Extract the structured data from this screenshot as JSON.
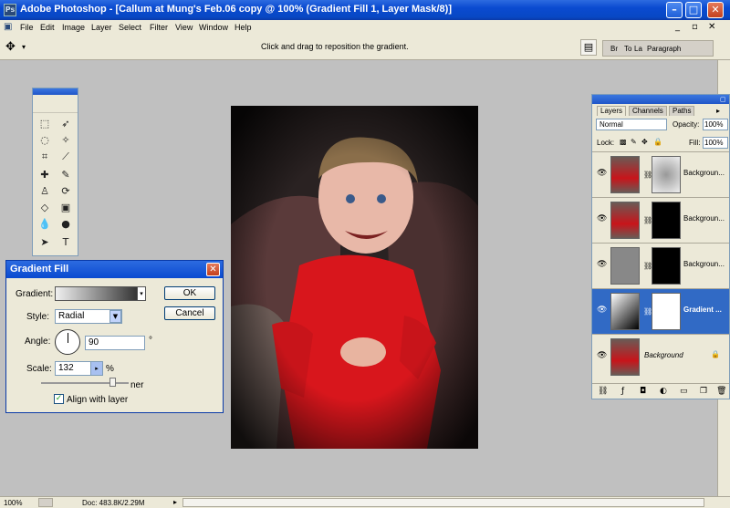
{
  "window": {
    "title": "Adobe Photoshop - [Callum at Mung's Feb.06 copy @ 100% (Gradient Fill 1, Layer Mask/8)]"
  },
  "menu": [
    "File",
    "Edit",
    "Image",
    "Layer",
    "Select",
    "Filter",
    "View",
    "Window",
    "Help"
  ],
  "options": {
    "hint": "Click and drag to reposition the gradient."
  },
  "palette_well": {
    "tabs": [
      "Br",
      "To",
      "La",
      "Paragraph"
    ]
  },
  "dialog": {
    "title": "Gradient Fill",
    "gradient_label": "Gradient:",
    "style_label": "Style:",
    "style_value": "Radial",
    "angle_label": "Angle:",
    "angle_value": "90",
    "angle_unit": "°",
    "scale_label": "Scale:",
    "scale_value": "132",
    "scale_unit": "%",
    "partial_text": "ner",
    "align_label": "Align with layer",
    "ok": "OK",
    "cancel": "Cancel"
  },
  "layers": {
    "tabs": [
      "Layers",
      "Channels",
      "Paths"
    ],
    "blend_mode": "Normal",
    "opacity_label": "Opacity:",
    "opacity_value": "100%",
    "lock_label": "Lock:",
    "fill_label": "Fill:",
    "fill_value": "100%",
    "rows": [
      {
        "name": "Backgroun..."
      },
      {
        "name": "Backgroun..."
      },
      {
        "name": "Backgroun..."
      },
      {
        "name": "Gradient ..."
      },
      {
        "name": "Background"
      }
    ]
  },
  "status": {
    "zoom": "100%",
    "doc": "Doc: 483.8K/2.29M"
  },
  "colors": {
    "titlebar": "#0a4ad0",
    "selection": "#316ac5",
    "workspace": "#c0c0c0",
    "chrome": "#ece9d8"
  }
}
